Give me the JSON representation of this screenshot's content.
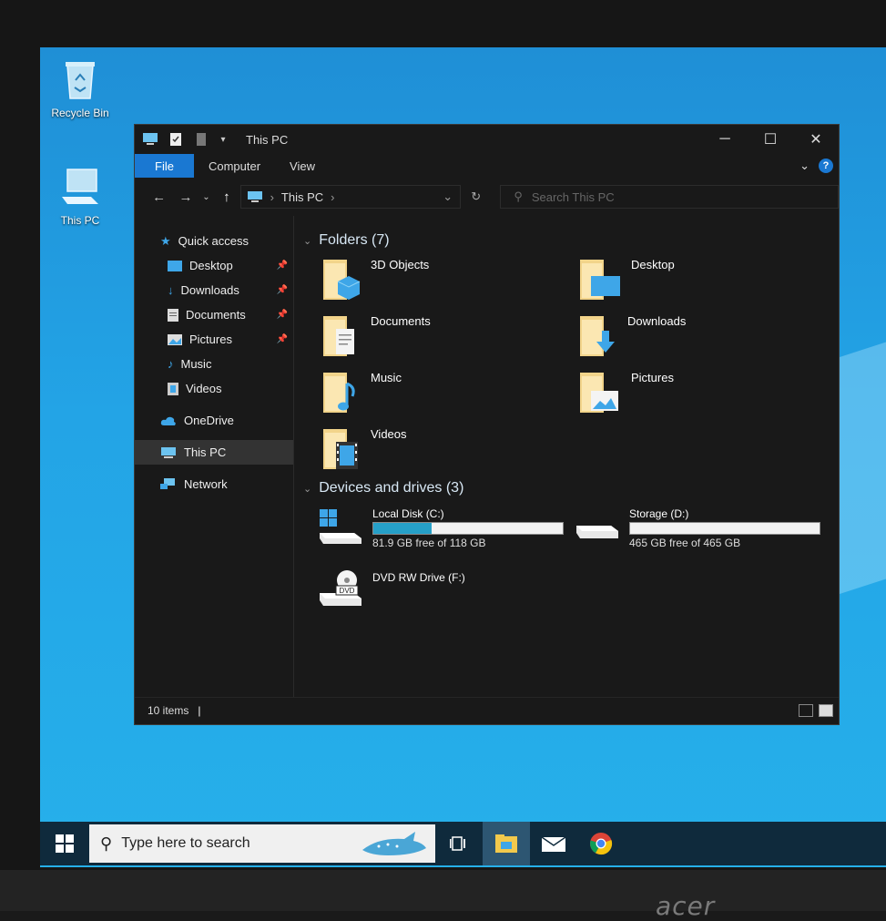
{
  "desktop": {
    "icons": [
      {
        "label": "Recycle Bin"
      },
      {
        "label": "This PC"
      }
    ]
  },
  "window": {
    "title": "This PC",
    "ribbon_tabs": [
      "File",
      "Computer",
      "View"
    ],
    "address": {
      "segment": "This PC"
    },
    "search_placeholder": "Search This PC",
    "nav": {
      "quick_access": "Quick access",
      "quick_items": [
        {
          "label": "Desktop",
          "pinned": true
        },
        {
          "label": "Downloads",
          "pinned": true
        },
        {
          "label": "Documents",
          "pinned": true
        },
        {
          "label": "Pictures",
          "pinned": true
        },
        {
          "label": "Music",
          "pinned": false
        },
        {
          "label": "Videos",
          "pinned": false
        }
      ],
      "onedrive": "OneDrive",
      "this_pc": "This PC",
      "network": "Network"
    },
    "folders_header": "Folders (7)",
    "folders": [
      "3D Objects",
      "Desktop",
      "Documents",
      "Downloads",
      "Music",
      "Pictures",
      "Videos"
    ],
    "drives_header": "Devices and drives (3)",
    "drives": [
      {
        "name": "Local Disk (C:)",
        "free_text": "81.9 GB free of 118 GB",
        "used_fraction": 0.31
      },
      {
        "name": "Storage (D:)",
        "free_text": "465 GB free of 465 GB",
        "used_fraction": 0.0
      },
      {
        "name": "DVD RW Drive (F:)",
        "free_text": "",
        "used_fraction": null
      }
    ],
    "status": "10 items"
  },
  "taskbar": {
    "search_placeholder": "Type here to search"
  },
  "monitor_brand": "acer",
  "colors": {
    "accent": "#1a78d2",
    "drive_fill": "#26a0c8",
    "desktop": "#23a4e6"
  }
}
